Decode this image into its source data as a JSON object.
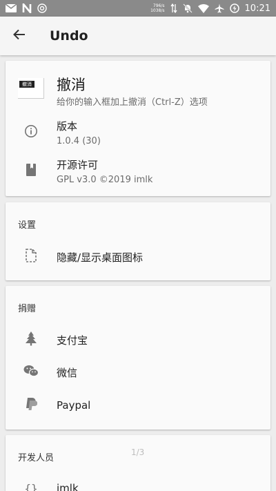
{
  "status_bar": {
    "left_icons": [
      "mail-icon",
      "n-app-icon",
      "at-sign-icon"
    ],
    "net_speed_up": "796/s",
    "net_speed_down": "1038/s",
    "right_icons": [
      "data-arrows-icon",
      "mute-bell-icon",
      "wifi-icon",
      "airplane-icon",
      "battery-charging-icon"
    ],
    "time": "10:21"
  },
  "app_bar": {
    "title": "Undo",
    "back_icon": "arrow-back-icon"
  },
  "about": {
    "app_icon_text": "撤消",
    "app_name": "撤消",
    "app_desc": "给你的输入框加上撤消（Ctrl-Z）选项",
    "version_label": "版本",
    "version_value": "1.0.4 (30)",
    "license_label": "开源许可",
    "license_value": "GPL v3.0 ©2019 imlk"
  },
  "settings": {
    "title": "设置",
    "hide_icon_label": "隐藏/显示桌面图标"
  },
  "donate": {
    "title": "捐赠",
    "items": [
      {
        "label": "支付宝",
        "icon": "alipay-tree-icon"
      },
      {
        "label": "微信",
        "icon": "wechat-icon"
      },
      {
        "label": "Paypal",
        "icon": "paypal-icon"
      }
    ]
  },
  "developers": {
    "title": "开发人员",
    "page_indicator": "1/3",
    "first_dev": "imlk"
  },
  "colors": {
    "status_bar": "#8a8a8a",
    "app_bar": "#f5f5f5",
    "background": "#ededed",
    "card": "#fafafa"
  }
}
